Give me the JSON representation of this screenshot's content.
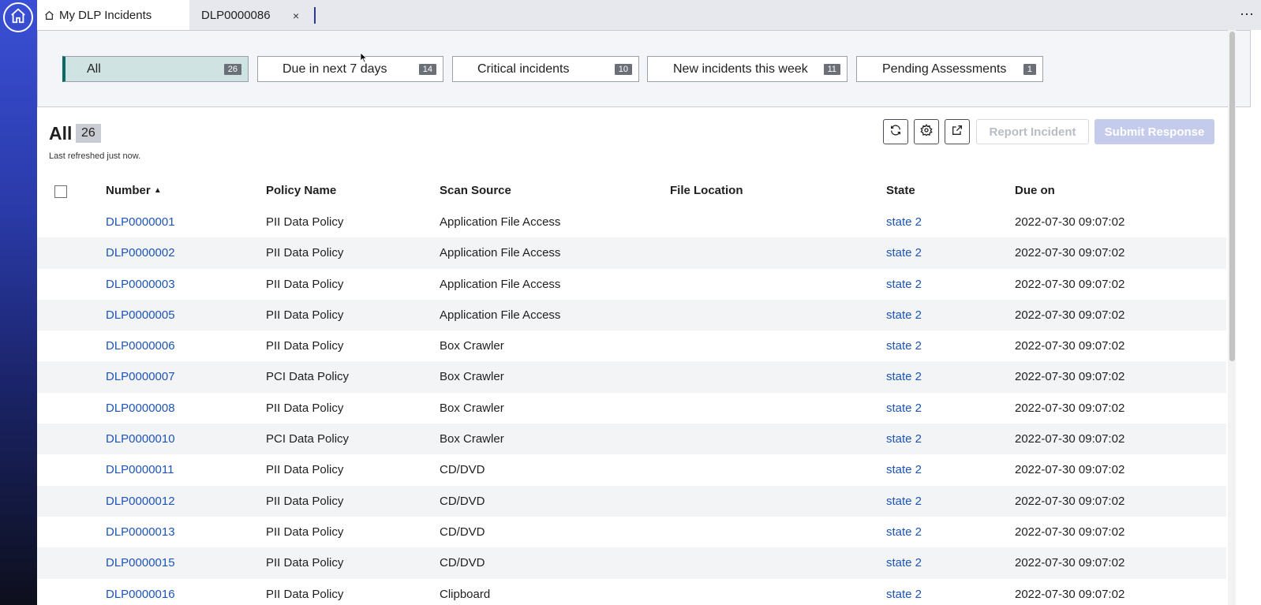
{
  "tabs": {
    "active_label": "My DLP Incidents",
    "second_label": "DLP0000086",
    "close_symbol": "×",
    "more_symbol": "⋯"
  },
  "filters": [
    {
      "label": "All",
      "count": "26"
    },
    {
      "label": "Due in next 7 days",
      "count": "14"
    },
    {
      "label": "Critical incidents",
      "count": "10"
    },
    {
      "label": "New incidents this week",
      "count": "11"
    },
    {
      "label": "Pending Assessments",
      "count": "1"
    }
  ],
  "list": {
    "title": "All",
    "count": "26",
    "refreshed": "Last refreshed just now.",
    "report_button": "Report Incident",
    "submit_button": "Submit Response"
  },
  "columns": {
    "number": "Number",
    "sort_indicator": "▲",
    "policy": "Policy Name",
    "source": "Scan Source",
    "location": "File Location",
    "state": "State",
    "due": "Due on"
  },
  "rows": [
    {
      "number": "DLP0000001",
      "policy": "PII Data Policy",
      "source": "Application File Access",
      "location": "",
      "state": "state 2",
      "due": "2022-07-30 09:07:02"
    },
    {
      "number": "DLP0000002",
      "policy": "PII Data Policy",
      "source": "Application File Access",
      "location": "",
      "state": "state 2",
      "due": "2022-07-30 09:07:02"
    },
    {
      "number": "DLP0000003",
      "policy": "PII Data Policy",
      "source": "Application File Access",
      "location": "",
      "state": "state 2",
      "due": "2022-07-30 09:07:02"
    },
    {
      "number": "DLP0000005",
      "policy": "PII Data Policy",
      "source": "Application File Access",
      "location": "",
      "state": "state 2",
      "due": "2022-07-30 09:07:02"
    },
    {
      "number": "DLP0000006",
      "policy": "PII Data Policy",
      "source": "Box Crawler",
      "location": "",
      "state": "state 2",
      "due": "2022-07-30 09:07:02"
    },
    {
      "number": "DLP0000007",
      "policy": "PCI Data Policy",
      "source": "Box Crawler",
      "location": "",
      "state": "state 2",
      "due": "2022-07-30 09:07:02"
    },
    {
      "number": "DLP0000008",
      "policy": "PII Data Policy",
      "source": "Box Crawler",
      "location": "",
      "state": "state 2",
      "due": "2022-07-30 09:07:02"
    },
    {
      "number": "DLP0000010",
      "policy": "PCI Data Policy",
      "source": "Box Crawler",
      "location": "",
      "state": "state 2",
      "due": "2022-07-30 09:07:02"
    },
    {
      "number": "DLP0000011",
      "policy": "PII Data Policy",
      "source": "CD/DVD",
      "location": "",
      "state": "state 2",
      "due": "2022-07-30 09:07:02"
    },
    {
      "number": "DLP0000012",
      "policy": "PII Data Policy",
      "source": "CD/DVD",
      "location": "",
      "state": "state 2",
      "due": "2022-07-30 09:07:02"
    },
    {
      "number": "DLP0000013",
      "policy": "PII Data Policy",
      "source": "CD/DVD",
      "location": "",
      "state": "state 2",
      "due": "2022-07-30 09:07:02"
    },
    {
      "number": "DLP0000015",
      "policy": "PII Data Policy",
      "source": "CD/DVD",
      "location": "",
      "state": "state 2",
      "due": "2022-07-30 09:07:02"
    },
    {
      "number": "DLP0000016",
      "policy": "PII Data Policy",
      "source": "Clipboard",
      "location": "",
      "state": "state 2",
      "due": "2022-07-30 09:07:02"
    }
  ],
  "colors": {
    "accent_link": "#1d54b5",
    "selected_card": "#cfe4e2",
    "selected_border": "#0a6b66",
    "submit_disabled": "#c5cbeb"
  },
  "icons": [
    "home-icon",
    "refresh-icon",
    "gear-icon",
    "export-icon",
    "close-icon",
    "more-icon"
  ]
}
